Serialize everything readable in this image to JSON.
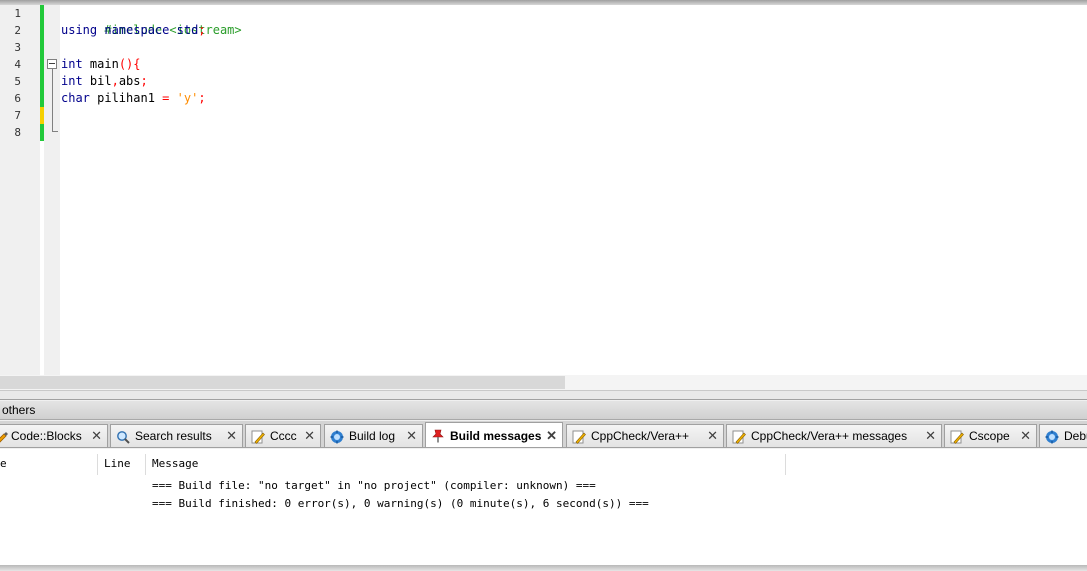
{
  "editor": {
    "line_numbers": [
      "1",
      "2",
      "3",
      "4",
      "5",
      "6",
      "7",
      "8"
    ],
    "code": {
      "line1": {
        "directive": "#include <iostream>"
      },
      "line2": {
        "kw1": "using",
        "sp1": " ",
        "kw2": "namespace",
        "sp2": " ",
        "ident": "std",
        "op": ";"
      },
      "line4": {
        "kw": "int",
        "rest": " main",
        "op": "(){"
      },
      "line5": {
        "kw": "int",
        "a": " bil",
        "op1": ",",
        "b": "abs",
        "op2": ";"
      },
      "line6": {
        "kw": "char",
        "a": " pilihan1 ",
        "op1": "=",
        "sp": " ",
        "str": "'y'",
        "op2": ";"
      }
    },
    "change_markers": {
      "saved_color": "#22c93a",
      "unsaved_color": "#f5d000"
    }
  },
  "panel": {
    "title": "others",
    "tabs": [
      {
        "label": "Code::Blocks",
        "icon": "codeblocks-icon",
        "close": "✕",
        "active": false
      },
      {
        "label": "Search results",
        "icon": "magnifier-icon",
        "close": "✕",
        "active": false
      },
      {
        "label": "Cccc",
        "icon": "pencil-doc-icon",
        "close": "✕",
        "active": false
      },
      {
        "label": "Build log",
        "icon": "gear-icon",
        "close": "✕",
        "active": false
      },
      {
        "label": "Build messages",
        "icon": "pushpin-icon",
        "close": "✕",
        "active": true
      },
      {
        "label": "CppCheck/Vera++",
        "icon": "pencil-doc-icon",
        "close": "✕",
        "active": false
      },
      {
        "label": "CppCheck/Vera++ messages",
        "icon": "pencil-doc-icon",
        "close": "✕",
        "active": false
      },
      {
        "label": "Cscope",
        "icon": "pencil-doc-icon",
        "close": "✕",
        "active": false
      },
      {
        "label": "Debu",
        "icon": "gear-icon",
        "close": "",
        "active": false
      }
    ],
    "columns": {
      "file": "e",
      "line": "Line",
      "message": "Message"
    },
    "messages": [
      "=== Build file: \"no target\" in \"no project\" (compiler: unknown) ===",
      "=== Build finished: 0 error(s), 0 warning(s) (0 minute(s), 6 second(s)) ==="
    ]
  }
}
